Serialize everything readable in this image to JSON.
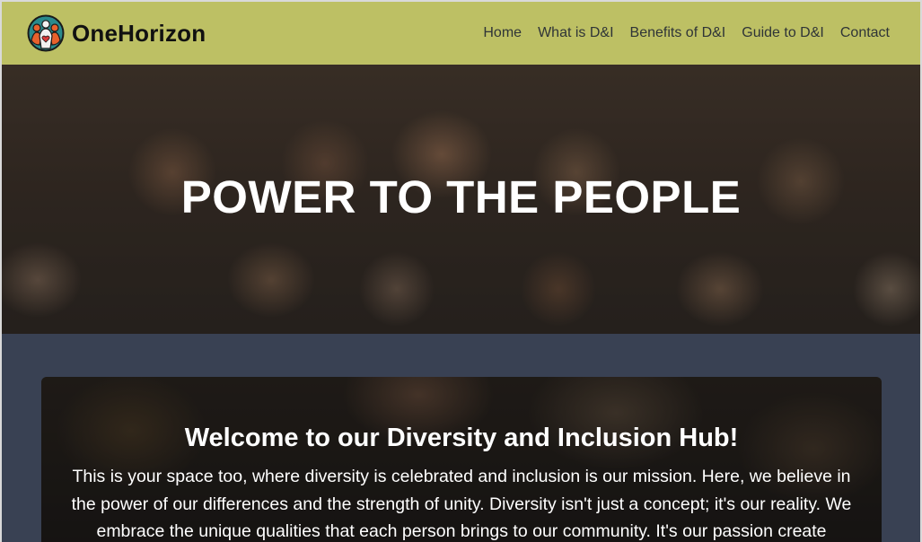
{
  "brand": {
    "name": "OneHorizon",
    "logo_icon": "people-group-heart-icon"
  },
  "nav": {
    "items": [
      {
        "label": "Home"
      },
      {
        "label": "What is D&I"
      },
      {
        "label": "Benefits of D&I"
      },
      {
        "label": "Guide to D&I"
      },
      {
        "label": "Contact"
      }
    ]
  },
  "hero": {
    "title": "POWER TO THE PEOPLE"
  },
  "welcome": {
    "title": "Welcome to our Diversity and Inclusion Hub!",
    "body": "This is your space too, where diversity is celebrated and inclusion is our mission. Here, we believe in the power of our differences and the strength of unity. Diversity isn't just a concept; it's our reality. We embrace the unique qualities that each person brings to our community. It's our passion create"
  },
  "colors": {
    "navbar": "#bdc064",
    "page_background": "#394153",
    "hero_text": "#ffffff",
    "logo_teal": "#2a8a8c",
    "logo_orange": "#e8612c"
  }
}
